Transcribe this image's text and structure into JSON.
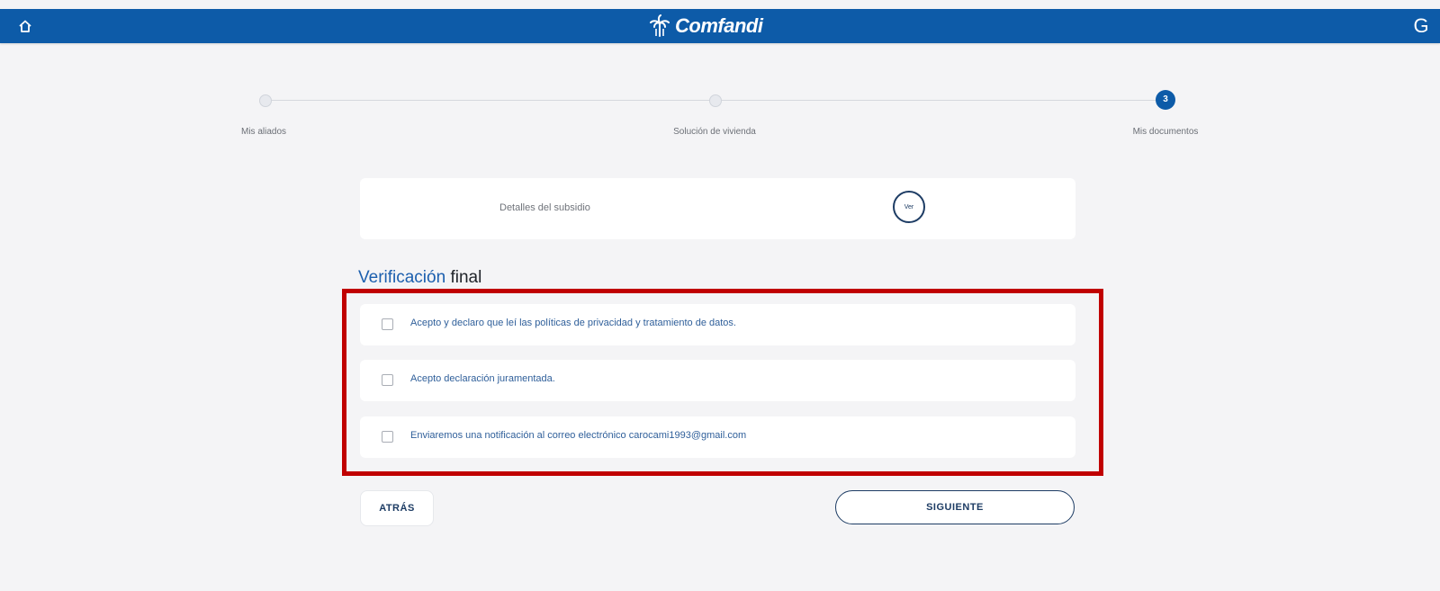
{
  "header": {
    "brand": "Comfandi",
    "home_icon": "home-icon",
    "user_initial": "G",
    "bar_color": "#0d5ba8"
  },
  "stepper": {
    "steps": [
      {
        "label": "Mis aliados",
        "active": false
      },
      {
        "label": "Solución de vivienda",
        "active": false
      },
      {
        "label": "Mis documentos",
        "active": true,
        "number": "3"
      }
    ]
  },
  "details": {
    "label": "Detalles del subsidio",
    "badge": "Ver"
  },
  "verification": {
    "title_accent": "Verificación",
    "title_rest": "final",
    "items": [
      {
        "text": "Acepto y declaro que leí las políticas de privacidad y tratamiento de datos.",
        "checked": false
      },
      {
        "text": "Acepto declaración juramentada.",
        "checked": false
      },
      {
        "text": "Enviaremos una notificación al correo electrónico carocami1993@gmail.com",
        "checked": false
      }
    ]
  },
  "actions": {
    "back_label": "ATRÁS",
    "next_label": "SIGUIENTE"
  }
}
